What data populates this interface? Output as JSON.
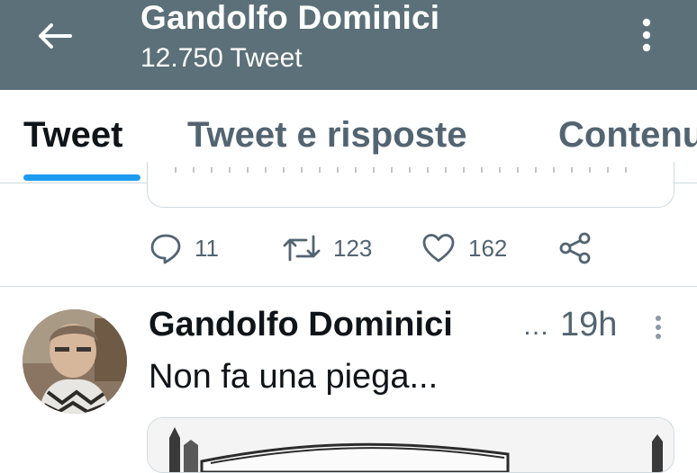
{
  "header": {
    "title": "Gandolfo Dominici",
    "subtitle": "12.750 Tweet",
    "back_icon": "arrow-left-icon",
    "more_icon": "more-vertical-icon",
    "background_color": "#5b7078"
  },
  "tabs": [
    {
      "label": "Tweet",
      "active": true
    },
    {
      "label": "Tweet e risposte",
      "active": false
    },
    {
      "label": "Contenuti multimediali",
      "active": false
    }
  ],
  "previous_tweet": {
    "actions": {
      "replies": "11",
      "retweets": "123",
      "likes": "162"
    }
  },
  "tweet": {
    "author": "Gandolfo Dominici",
    "handle_truncation": "…",
    "time": "19h",
    "text": "Non fa una piega..."
  },
  "colors": {
    "accent": "#1d9bf0",
    "muted_text": "#536471",
    "divider": "#cfd9de"
  }
}
